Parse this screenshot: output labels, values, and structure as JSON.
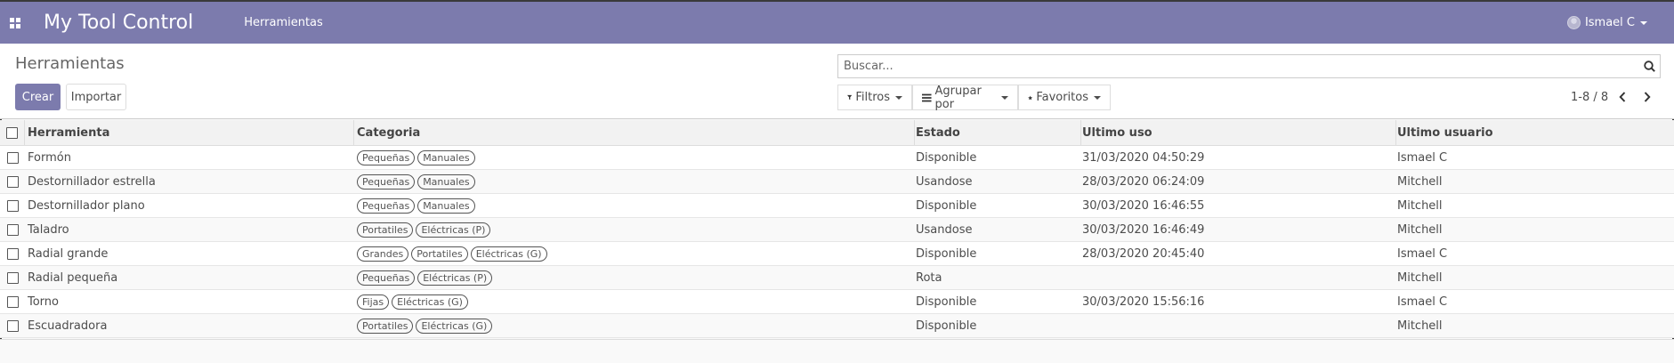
{
  "navbar": {
    "apps_icon": "apps-grid-icon",
    "brand": "My Tool Control",
    "menu_item": "Herramientas",
    "user_name": "Ismael C"
  },
  "control_panel": {
    "title": "Herramientas",
    "create_label": "Crear",
    "import_label": "Importar",
    "search_placeholder": "Buscar...",
    "filters_label": "Filtros",
    "group_by_label": "Agrupar por",
    "favorites_label": "Favoritos",
    "pager": "1-8 / 8"
  },
  "colors": {
    "brand": "#7c7bad"
  },
  "table": {
    "headers": [
      "Herramienta",
      "Categoria",
      "Estado",
      "Ultimo uso",
      "Ultimo usuario"
    ],
    "rows": [
      {
        "tool": "Formón",
        "tags": [
          "Pequeñas",
          "Manuales"
        ],
        "state": "Disponible",
        "last_use": "31/03/2020 04:50:29",
        "last_user": "Ismael C"
      },
      {
        "tool": "Destornillador estrella",
        "tags": [
          "Pequeñas",
          "Manuales"
        ],
        "state": "Usandose",
        "last_use": "28/03/2020 06:24:09",
        "last_user": "Mitchell"
      },
      {
        "tool": "Destornillador plano",
        "tags": [
          "Pequeñas",
          "Manuales"
        ],
        "state": "Disponible",
        "last_use": "30/03/2020 16:46:55",
        "last_user": "Mitchell"
      },
      {
        "tool": "Taladro",
        "tags": [
          "Portatiles",
          "Eléctricas (P)"
        ],
        "state": "Usandose",
        "last_use": "30/03/2020 16:46:49",
        "last_user": "Mitchell"
      },
      {
        "tool": "Radial grande",
        "tags": [
          "Grandes",
          "Portatiles",
          "Eléctricas (G)"
        ],
        "state": "Disponible",
        "last_use": "28/03/2020 20:45:40",
        "last_user": "Ismael C"
      },
      {
        "tool": "Radial pequeña",
        "tags": [
          "Pequeñas",
          "Eléctricas (P)"
        ],
        "state": "Rota",
        "last_use": "",
        "last_user": "Mitchell"
      },
      {
        "tool": "Torno",
        "tags": [
          "Fijas",
          "Eléctricas (G)"
        ],
        "state": "Disponible",
        "last_use": "30/03/2020 15:56:16",
        "last_user": "Ismael C"
      },
      {
        "tool": "Escuadradora",
        "tags": [
          "Portatiles",
          "Eléctricas (G)"
        ],
        "state": "Disponible",
        "last_use": "",
        "last_user": "Mitchell"
      }
    ]
  }
}
